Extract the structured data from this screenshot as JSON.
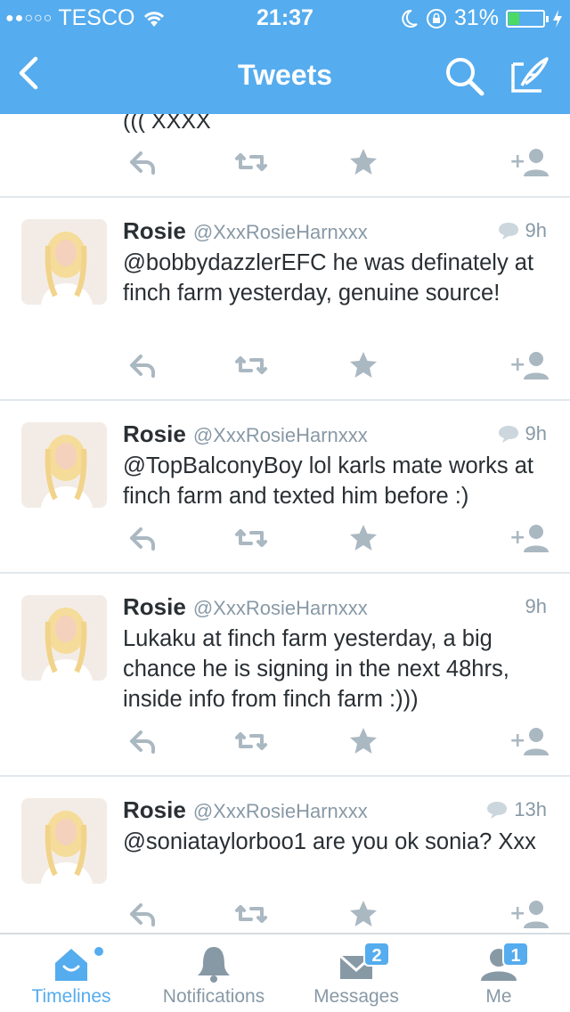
{
  "status_bar": {
    "signal": "●●○○○",
    "carrier": "TESCO",
    "time": "21:37",
    "battery_percent": "31%",
    "battery_level": 0.31,
    "battery_color": "#4cd964"
  },
  "nav": {
    "title": "Tweets",
    "back_icon": "chevron-left-icon",
    "search_icon": "search-icon",
    "compose_icon": "compose-icon"
  },
  "partial_tweet": {
    "text": "((( XXXX"
  },
  "tweets": [
    {
      "name": "Rosie",
      "handle": "@XxxRosieHarnxxx",
      "time": "9h",
      "has_conversation": true,
      "text": "@bobbydazzlerEFC he was definately at finch farm yesterday, genuine source!"
    },
    {
      "name": "Rosie",
      "handle": "@XxxRosieHarnxxx",
      "time": "9h",
      "has_conversation": true,
      "text": "@TopBalconyBoy lol karls mate works at finch farm and texted him before :)"
    },
    {
      "name": "Rosie",
      "handle": "@XxxRosieHarnxxx",
      "time": "9h",
      "has_conversation": false,
      "text": "Lukaku at finch farm yesterday, a big chance he is signing in the next 48hrs, inside info from finch farm :)))"
    },
    {
      "name": "Rosie",
      "handle": "@XxxRosieHarnxxx",
      "time": "13h",
      "has_conversation": true,
      "text": "@soniataylorboo1 are you ok sonia? Xxx"
    }
  ],
  "tabbar": {
    "tabs": [
      {
        "label": "Timelines",
        "icon": "home-icon",
        "active": true,
        "badge": ""
      },
      {
        "label": "Notifications",
        "icon": "bell-icon",
        "active": false,
        "badge": ""
      },
      {
        "label": "Messages",
        "icon": "envelope-icon",
        "active": false,
        "badge": "2"
      },
      {
        "label": "Me",
        "icon": "person-icon",
        "active": false,
        "badge": "1"
      }
    ]
  },
  "colors": {
    "brand": "#55acee",
    "action_icon": "#aab8c2",
    "divider": "#e1e8ed"
  }
}
